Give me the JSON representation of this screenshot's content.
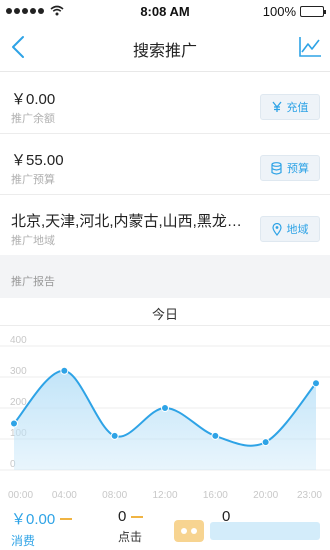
{
  "status_bar": {
    "time": "8:08 AM",
    "battery": "100%",
    "signal_dots": 5,
    "battery_level": 1.0
  },
  "nav": {
    "title": "搜索推广",
    "back_icon": "chevron-left-icon",
    "chart_icon": "line-chart-icon"
  },
  "rows": [
    {
      "value": "￥0.00",
      "label": "推广余额",
      "button": "充值",
      "icon": "yen-icon"
    },
    {
      "value": "￥55.00",
      "label": "推广预算",
      "button": "预算",
      "icon": "database-icon"
    },
    {
      "value": "北京,天津,河北,内蒙古,山西,黑龙…",
      "label": "推广地域",
      "button": "地域",
      "icon": "location-pin-icon"
    }
  ],
  "report": {
    "section_title": "推广报告",
    "tab": "今日"
  },
  "chart_data": {
    "type": "area",
    "x": [
      "00:00",
      "04:00",
      "08:00",
      "12:00",
      "16:00",
      "20:00",
      "23:00"
    ],
    "series": [
      {
        "values": [
          150,
          320,
          110,
          200,
          110,
          90,
          280
        ]
      }
    ],
    "ylim": [
      0,
      400
    ],
    "yticks": [
      "0",
      "100",
      "200",
      "300",
      "400"
    ],
    "grid": true,
    "colors": {
      "line": "#2ea3e6",
      "fill": "#bfe3f8",
      "grid": "#ececec"
    }
  },
  "footer": {
    "cost_value": "￥0.00",
    "cost_label": "消费",
    "clicks_value": "0",
    "clicks_label": "点击",
    "third_value": "0"
  },
  "colors": {
    "accent": "#2ea3e6",
    "dash": "#f0b443",
    "background_gray": "#f3f4f6"
  }
}
